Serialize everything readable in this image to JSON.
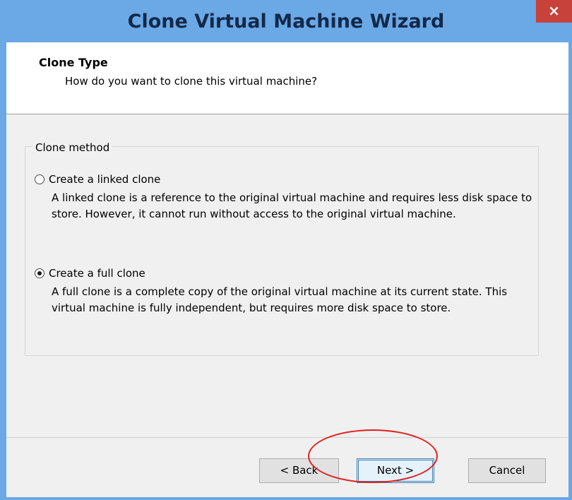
{
  "window": {
    "title": "Clone Virtual Machine Wizard",
    "close_glyph": "×",
    "title_bar_color": "#6ba8e6"
  },
  "header": {
    "title": "Clone Type",
    "subtitle": "How do you want to clone this virtual machine?"
  },
  "clone_method": {
    "legend": "Clone method",
    "selected": "full",
    "options": [
      {
        "label": "Create a linked clone",
        "checked": false,
        "description": "A linked clone is a reference to the original virtual machine and requires less disk space to store. However, it cannot run without access to the original virtual machine."
      },
      {
        "label": "Create a full clone",
        "checked": true,
        "description": "A full clone is a complete copy of the original virtual machine at its current state. This virtual machine is fully independent, but requires more disk space to store."
      }
    ]
  },
  "footer": {
    "back_label": "< Back",
    "next_label": "Next >",
    "cancel_label": "Cancel"
  },
  "annotation": {
    "highlight_color": "#e02020",
    "highlight_target": "next-button"
  },
  "icons": {
    "close": "close-icon",
    "radio_unchecked": "radio-unchecked-icon",
    "radio_checked": "radio-checked-icon"
  }
}
